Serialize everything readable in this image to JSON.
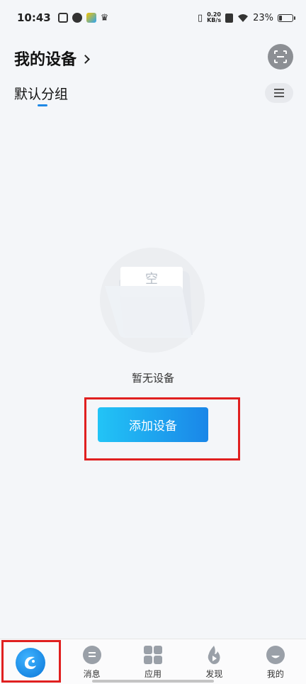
{
  "status_bar": {
    "time": "10:43",
    "net_speed_value": "0.20",
    "net_speed_unit": "KB/s",
    "battery": "23%",
    "battery_level": 0.23
  },
  "header": {
    "title": "我的设备"
  },
  "group": {
    "active_tab": "默认分组"
  },
  "empty_state": {
    "illustration_text": "空",
    "message": "暂无设备",
    "add_button_label": "添加设备"
  },
  "bottom_nav": {
    "items": [
      {
        "label": "",
        "icon": "home-logo-icon"
      },
      {
        "label": "消息",
        "icon": "message-icon"
      },
      {
        "label": "应用",
        "icon": "apps-grid-icon"
      },
      {
        "label": "发现",
        "icon": "discover-flame-icon"
      },
      {
        "label": "我的",
        "icon": "profile-icon"
      }
    ]
  },
  "colors": {
    "accent": "#1e88e5",
    "button_gradient_start": "#22c4f6",
    "button_gradient_end": "#1a86e8",
    "highlight": "#e02020",
    "nav_icon": "#9aa0a8"
  }
}
